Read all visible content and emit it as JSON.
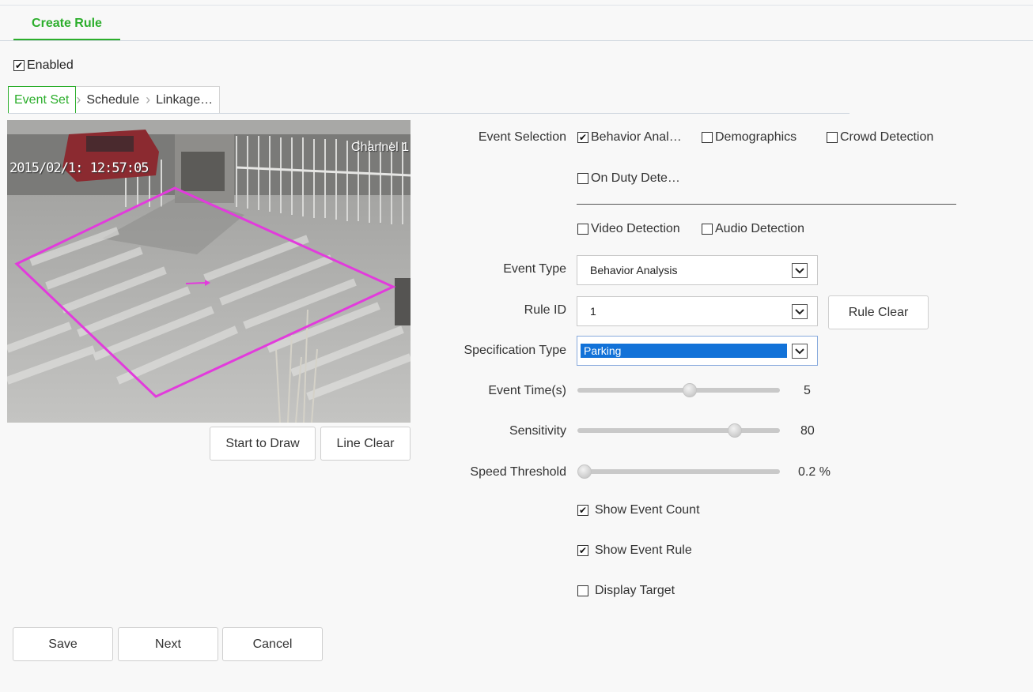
{
  "header": {
    "tab_label": "Create Rule"
  },
  "enabled": {
    "label": "Enabled",
    "checked": true
  },
  "steps": [
    {
      "label": "Event Set",
      "active": true
    },
    {
      "label": "Schedule",
      "active": false
    },
    {
      "label": "Linkage…",
      "active": false
    }
  ],
  "video": {
    "timestamp": "2015/02/1: 12:57:05",
    "channel": "Channel 1",
    "region_color": "#e23bdc"
  },
  "draw_buttons": {
    "start": "Start to Draw",
    "clear": "Line Clear"
  },
  "event_selection": {
    "label": "Event Selection",
    "options": [
      {
        "label": "Behavior Anal…",
        "checked": true
      },
      {
        "label": "Demographics",
        "checked": false
      },
      {
        "label": "Crowd Detection",
        "checked": false
      },
      {
        "label": "On Duty Dete…",
        "checked": false
      },
      {
        "label": "Video Detection",
        "checked": false
      },
      {
        "label": "Audio Detection",
        "checked": false
      }
    ]
  },
  "event_type": {
    "label": "Event Type",
    "value": "Behavior Analysis"
  },
  "rule_id": {
    "label": "Rule ID",
    "value": "1",
    "clear_label": "Rule Clear"
  },
  "spec_type": {
    "label": "Specification Type",
    "value": "Parking"
  },
  "event_time": {
    "label": "Event Time(s)",
    "value": "5",
    "fraction": 0.56
  },
  "sensitivity": {
    "label": "Sensitivity",
    "value": "80",
    "fraction": 0.8
  },
  "speed_threshold": {
    "label": "Speed Threshold",
    "value": "0.2",
    "unit": "%",
    "fraction": 0.0
  },
  "display_options": [
    {
      "label": "Show Event Count",
      "checked": true
    },
    {
      "label": "Show Event Rule",
      "checked": true
    },
    {
      "label": "Display Target",
      "checked": false
    }
  ],
  "footer": {
    "save": "Save",
    "next": "Next",
    "cancel": "Cancel"
  },
  "colors": {
    "accent": "#2cae2c",
    "selection": "#1272d8"
  }
}
